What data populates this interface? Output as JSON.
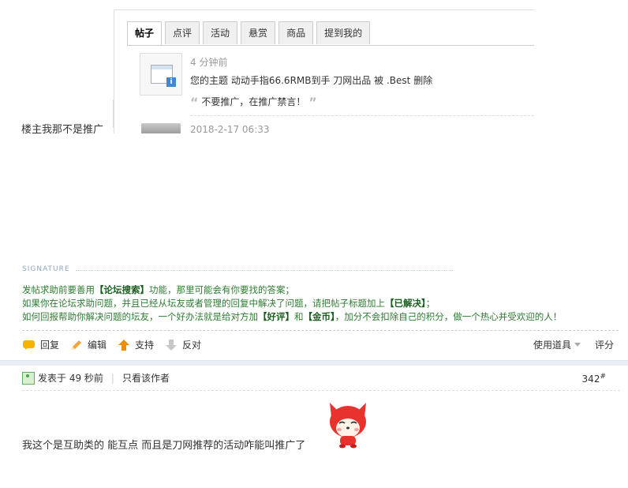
{
  "notice_popup": {
    "tabs": [
      {
        "label": "帖子",
        "active": true
      },
      {
        "label": "点评",
        "active": false
      },
      {
        "label": "活动",
        "active": false
      },
      {
        "label": "悬赏",
        "active": false
      },
      {
        "label": "商品",
        "active": false
      },
      {
        "label": "提到我的",
        "active": false
      }
    ],
    "item1": {
      "time": "4 分钟前",
      "text_prefix": "您的主题",
      "thread_link": "动动手指66.6RMB到手 刀网出品",
      "by_word": "被",
      "user": ".Best",
      "action": "删除",
      "quote": "不要推广，在推广禁言！",
      "icon": "notice-icon"
    },
    "item2": {
      "time": "2018-2-17 06:33"
    }
  },
  "post1": {
    "content": "楼主我那不是推广",
    "signature_title": "SIGNATURE",
    "signature_lines": [
      {
        "a": "发帖求助前要善用",
        "b": "【论坛搜索】",
        "c": "功能，那里可能会有你要找的答案；",
        "d": "",
        "e": "",
        "f": ""
      },
      {
        "a": "如果你在论坛求助问题，并且已经从坛友或者管理的回复中解决了问题，请把帖子标题加上",
        "b": "【已解决】",
        "c": "；",
        "d": "",
        "e": "",
        "f": ""
      },
      {
        "a": "如何回报帮助你解决问题的坛友，一个好办法就是给对方加",
        "b": "【好评】",
        "c": "和",
        "d": "【金币】",
        "e": "，加分不会扣除自己的积分，做一个热心并受欢迎的人！",
        "f": ""
      }
    ],
    "actions": {
      "reply": "回复",
      "edit": "编辑",
      "support": "支持",
      "oppose": "反对",
      "tools": "使用道具",
      "rate": "评分"
    }
  },
  "post2": {
    "posted": "发表于 49 秒前",
    "author_only": "只看该作者",
    "floor": "342",
    "floor_mark": "#",
    "content": "我这个是互助类的 能互点 而且是刀网推荐的活动咋能叫推广了",
    "emoji": "red-fox-emoji"
  },
  "colors": {
    "signature_green": "#2e7d32",
    "support_arrow": "#f08c00",
    "reply_icon": "#f6b400",
    "fox_red": "#e8322e"
  }
}
